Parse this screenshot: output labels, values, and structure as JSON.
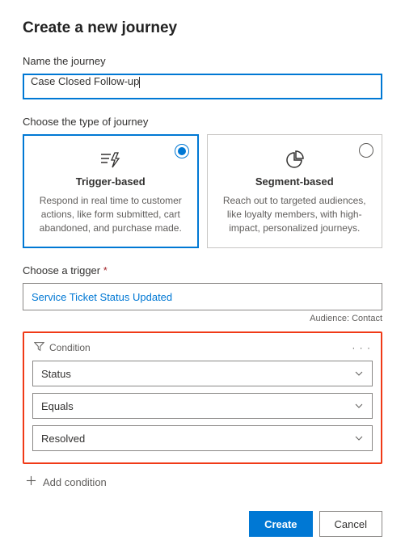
{
  "title": "Create a new journey",
  "name_field": {
    "label": "Name the journey",
    "value": "Case Closed Follow-up"
  },
  "type_section": {
    "label": "Choose the type of journey",
    "cards": [
      {
        "title": "Trigger-based",
        "desc": "Respond in real time to customer actions, like form submitted, cart abandoned, and purchase made.",
        "selected": true
      },
      {
        "title": "Segment-based",
        "desc": "Reach out to targeted audiences, like loyalty members, with high-impact, personalized journeys.",
        "selected": false
      }
    ]
  },
  "trigger_section": {
    "label": "Choose a trigger",
    "value": "Service Ticket Status Updated",
    "audience_label": "Audience: Contact"
  },
  "condition": {
    "header": "Condition",
    "attribute": "Status",
    "operator": "Equals",
    "value": "Resolved"
  },
  "add_condition_label": "Add condition",
  "buttons": {
    "create": "Create",
    "cancel": "Cancel"
  }
}
